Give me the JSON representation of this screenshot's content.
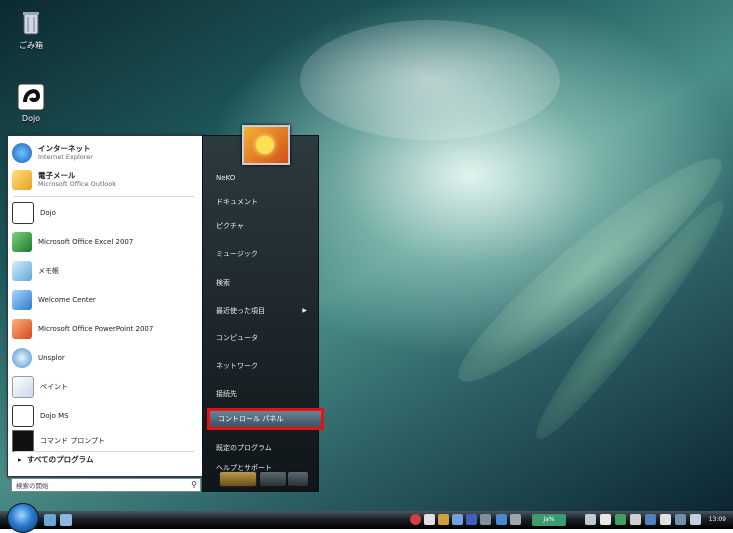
{
  "desktop": {
    "icons": [
      {
        "label": "ごみ箱"
      },
      {
        "label": "Dojo"
      }
    ]
  },
  "start_menu": {
    "pinned": [
      {
        "title": "インターネット",
        "subtitle": "Internet Explorer"
      },
      {
        "title": "電子メール",
        "subtitle": "Microsoft Office Outlook"
      }
    ],
    "recent": [
      {
        "label": "Dojo"
      },
      {
        "label": "Microsoft Office Excel 2007"
      },
      {
        "label": "メモ帳"
      },
      {
        "label": "Welcome Center"
      },
      {
        "label": "Microsoft Office PowerPoint 2007"
      },
      {
        "label": "Unsplor"
      },
      {
        "label": "ペイント"
      },
      {
        "label": "Dojo MS"
      },
      {
        "label": "コマンド プロンプト"
      }
    ],
    "all_programs": "すべてのプログラム",
    "search_placeholder": "検索の開始",
    "right_items": [
      {
        "label": "NeKO"
      },
      {
        "label": "ドキュメント"
      },
      {
        "label": "ピクチャ"
      },
      {
        "label": "ミュージック"
      },
      {
        "label": "検索"
      },
      {
        "label": "最近使った項目"
      },
      {
        "label": "コンピュータ"
      },
      {
        "label": "ネットワーク"
      },
      {
        "label": "接続先"
      },
      {
        "label": "コントロール パネル"
      },
      {
        "label": "既定のプログラム"
      },
      {
        "label": "ヘルプとサポート"
      }
    ],
    "highlight_color": "#e81010"
  },
  "taskbar": {
    "language": "Ja%",
    "clock": "13:09"
  }
}
